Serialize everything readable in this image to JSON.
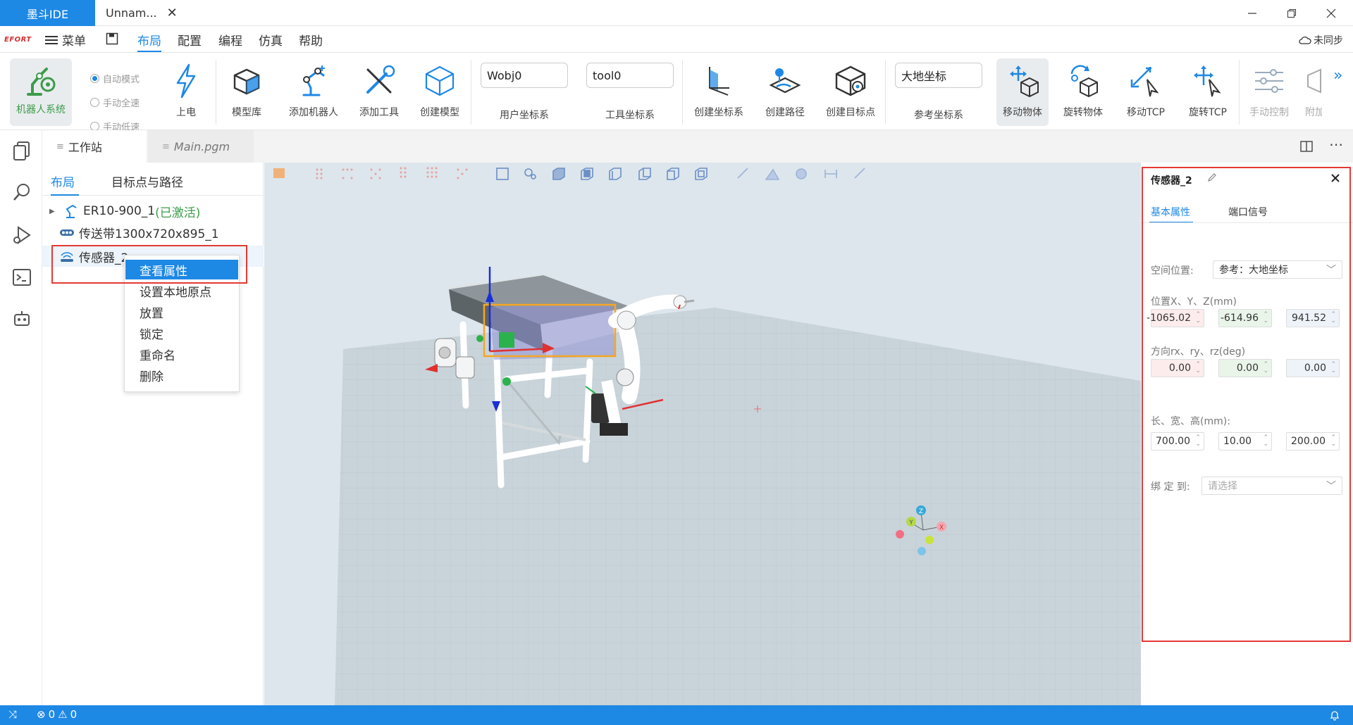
{
  "titlebar": {
    "app_tab": "墨斗IDE",
    "file_tab": "Unnam...",
    "close_glyph": "✕"
  },
  "menubar": {
    "logo": "EFORT",
    "menu_label": "菜单",
    "tabs": [
      "布局",
      "配置",
      "编程",
      "仿真",
      "帮助"
    ],
    "active_tab": "布局",
    "sync_label": "未同步"
  },
  "ribbon": {
    "robot_system": "机器人系统",
    "modes": [
      "自动模式",
      "手动全速",
      "手动低速"
    ],
    "power": "上电",
    "model_lib": "模型库",
    "add_robot": "添加机器人",
    "add_tool": "添加工具",
    "create_model": "创建模型",
    "user_frame": {
      "value": "Wobj0",
      "label": "用户坐标系"
    },
    "tool_frame": {
      "value": "tool0",
      "label": "工具坐标系"
    },
    "create_frame": "创建坐标系",
    "create_path": "创建路径",
    "create_target": "创建目标点",
    "ref_frame": {
      "value": "大地坐标",
      "label": "参考坐标系"
    },
    "move_object": "移动物体",
    "rotate_object": "旋转物体",
    "move_tcp": "移动TCP",
    "rotate_tcp": "旋转TCP",
    "manual_control": "手动控制",
    "attach": "附加",
    "more": "»"
  },
  "editor_tabs": {
    "workstation": "工作站",
    "main": "Main.pgm"
  },
  "side_panel": {
    "tabs": [
      "布局",
      "目标点与路径"
    ],
    "tree": [
      {
        "label": "ER10-900_1",
        "suffix": "(已激活)"
      },
      {
        "label": "传送带1300x720x895_1"
      },
      {
        "label": "传感器_2"
      }
    ]
  },
  "context_menu": [
    "查看属性",
    "设置本地原点",
    "放置",
    "锁定",
    "重命名",
    "删除"
  ],
  "properties": {
    "title": "传感器_2",
    "tabs": [
      "基本属性",
      "端口信号"
    ],
    "space_label": "空间位置:",
    "space_value": "参考：大地坐标",
    "pos_label": "位置X、Y、Z(mm)",
    "pos": [
      "-1065.02",
      "-614.96",
      "941.52"
    ],
    "rot_label": "方向rx、ry、rz(deg)",
    "rot": [
      "0.00",
      "0.00",
      "0.00"
    ],
    "size_label": "长、宽、高(mm):",
    "size": [
      "700.00",
      "10.00",
      "200.00"
    ],
    "bind_label": "绑 定 到:",
    "bind_placeholder": "请选择"
  },
  "axis_gizmo": {
    "z": "Z",
    "y": "Y",
    "x": "X"
  },
  "statusbar": {
    "errors": "0",
    "warnings": "0"
  },
  "colors": {
    "accent": "#1e88e5",
    "robot_green": "#3c9c4a",
    "highlight_red": "#e53935",
    "selection_orange": "#f5a623"
  }
}
